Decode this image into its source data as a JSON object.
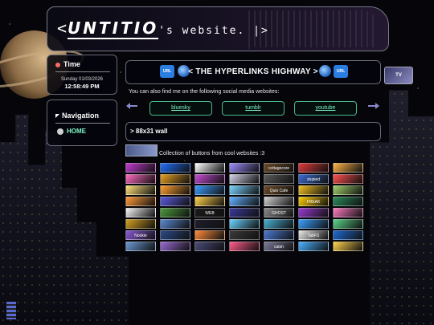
{
  "header": {
    "logo_text": "UNTITIO",
    "title_prefix": "<",
    "title_suffix": "'s website. |>"
  },
  "time_box": {
    "title": "Time",
    "date": "Sunday 01/03/2026",
    "time": "12:58:49 PM"
  },
  "navigation": {
    "title": "Navigation",
    "items": [
      {
        "label": "HOME"
      }
    ]
  },
  "hyperlinks": {
    "title": "< THE HYPERLINKS HIGHWAY >",
    "url_badge": "URL",
    "intro": "You can also find me on the following social media websites:",
    "links": [
      {
        "label": "bluesky"
      },
      {
        "label": "tumblr"
      },
      {
        "label": "youtube"
      }
    ]
  },
  "wall": {
    "title": "> 88x31 wall",
    "description": "Collection of buttons from cool websites :3"
  },
  "badges": [
    {
      "label": "",
      "color": "#c43bd1"
    },
    {
      "label": "",
      "color": "#1f6fff"
    },
    {
      "label": "",
      "color": "#ffffff"
    },
    {
      "label": "",
      "color": "#9b8cff"
    },
    {
      "label": "cottagecore",
      "color": "#6b4a2a"
    },
    {
      "label": "",
      "color": "#e13a3a"
    },
    {
      "label": "",
      "color": "#ffb347"
    },
    {
      "label": "",
      "color": "#ff6ac1"
    },
    {
      "label": "",
      "color": "#e8a020"
    },
    {
      "label": "",
      "color": "#c44bd4"
    },
    {
      "label": "",
      "color": "#d2d2e8"
    },
    {
      "label": "",
      "color": "#5a5a5a"
    },
    {
      "label": "stupied",
      "color": "#3a6ad4"
    },
    {
      "label": "",
      "color": "#ff4f4f"
    },
    {
      "label": "",
      "color": "#ffe27a"
    },
    {
      "label": "",
      "color": "#ffa030"
    },
    {
      "label": "",
      "color": "#3b9dff"
    },
    {
      "label": "",
      "color": "#7ad4ff"
    },
    {
      "label": "Quio Cafe",
      "color": "#6b4a2a"
    },
    {
      "label": "",
      "color": "#f0c020"
    },
    {
      "label": "",
      "color": "#9fd06b"
    },
    {
      "label": "",
      "color": "#ff9a3a"
    },
    {
      "label": "",
      "color": "#5a5ae0"
    },
    {
      "label": "",
      "color": "#ffd24a"
    },
    {
      "label": "",
      "color": "#60b0ff"
    },
    {
      "label": "",
      "color": "#d0d0d0"
    },
    {
      "label": "FREAK",
      "color": "#ffcc00"
    },
    {
      "label": "",
      "color": "#2a8a5a"
    },
    {
      "label": "",
      "color": "#f5f5f5"
    },
    {
      "label": "",
      "color": "#4a9a3a"
    },
    {
      "label": "WEB",
      "color": "#1a1a1a"
    },
    {
      "label": "",
      "color": "#3a3a9a"
    },
    {
      "label": "GHOST",
      "color": "#8a8a8a"
    },
    {
      "label": "",
      "color": "#9a3ad4"
    },
    {
      "label": "",
      "color": "#ff7ac1"
    },
    {
      "label": "",
      "color": "#d4a020"
    },
    {
      "label": "",
      "color": "#5a8ad4"
    },
    {
      "label": "",
      "color": "#1e1e2e"
    },
    {
      "label": "",
      "color": "#6ad4ff"
    },
    {
      "label": "",
      "color": "#4ab0d4"
    },
    {
      "label": "",
      "color": "#3aa0ff"
    },
    {
      "label": "",
      "color": "#5ad48a"
    },
    {
      "label": "Nookie",
      "color": "#8a5ad4"
    },
    {
      "label": "",
      "color": "#2a4a8a"
    },
    {
      "label": "",
      "color": "#ff8a3a"
    },
    {
      "label": "",
      "color": "#3a3a3a"
    },
    {
      "label": "",
      "color": "#4a7ad4"
    },
    {
      "label": "TabFS",
      "color": "#e8e8e8"
    },
    {
      "label": "",
      "color": "#1e6ad4"
    },
    {
      "label": "",
      "color": "#6a9ad4"
    },
    {
      "label": "",
      "color": "#9a6ad4"
    },
    {
      "label": "",
      "color": "#4a4a7a"
    },
    {
      "label": "",
      "color": "#ff5a8a"
    },
    {
      "label": "catsh",
      "color": "#7a7a9a"
    },
    {
      "label": "",
      "color": "#4ab0ff"
    },
    {
      "label": "",
      "color": "#ffd24a"
    }
  ]
}
